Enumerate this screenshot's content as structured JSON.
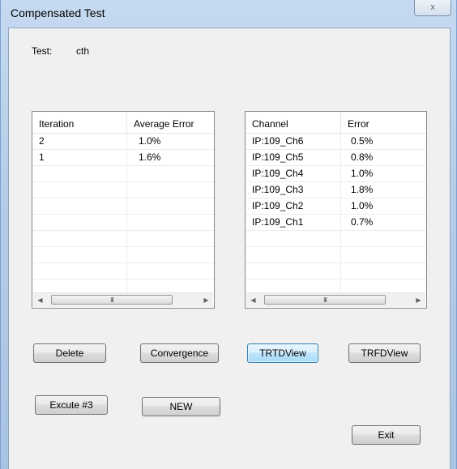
{
  "window": {
    "title": "Compensated Test",
    "close_glyph": "☓"
  },
  "test": {
    "label": "Test:",
    "value": "cth"
  },
  "iterations_table": {
    "columns": [
      "Iteration",
      "Average Error"
    ],
    "rows": [
      [
        "2",
        "1.0%"
      ],
      [
        "1",
        "1.6%"
      ]
    ],
    "scroll_grip": "III"
  },
  "channels_table": {
    "columns": [
      "Channel",
      "Error"
    ],
    "rows": [
      [
        "IP:109_Ch6",
        "0.5%"
      ],
      [
        "IP:109_Ch5",
        "0.8%"
      ],
      [
        "IP:109_Ch4",
        "1.0%"
      ],
      [
        "IP:109_Ch3",
        "1.8%"
      ],
      [
        "IP:109_Ch2",
        "1.0%"
      ],
      [
        "IP:109_Ch1",
        "0.7%"
      ]
    ],
    "scroll_grip": "III"
  },
  "buttons": {
    "delete": "Delete",
    "convergence": "Convergence",
    "trtdview": "TRTDView",
    "trfdview": "TRFDView",
    "excute": "Excute #3",
    "new": "NEW",
    "exit": "Exit"
  },
  "icons": {
    "scroll_left": "◀",
    "scroll_right": "▶"
  }
}
